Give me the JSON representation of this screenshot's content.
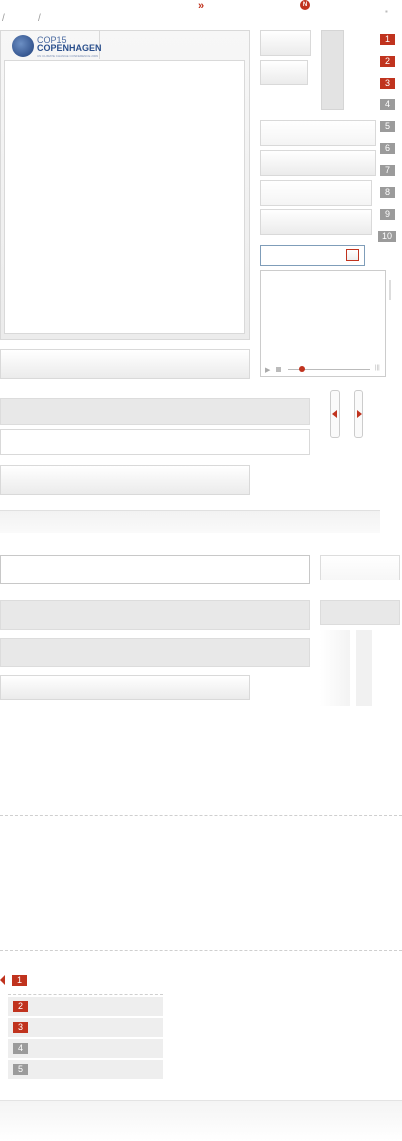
{
  "top": {
    "sep1": "/",
    "sep2": "/",
    "chevrons": "»",
    "n_badge": "N",
    "small_mark": "▪"
  },
  "logo": {
    "line1": "COP15",
    "line2": "COPENHAGEN",
    "line3": "UN CLIMATE CHANGE CONFERENCE 2009"
  },
  "side_numbers": [
    "1",
    "2",
    "3",
    "4",
    "5",
    "6",
    "7",
    "8",
    "9",
    "10"
  ],
  "bottom_list": [
    "1",
    "2",
    "3",
    "4",
    "5"
  ]
}
